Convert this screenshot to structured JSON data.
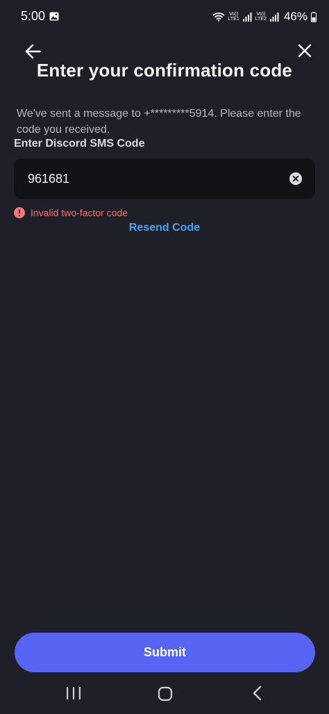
{
  "status_bar": {
    "time": "5:00",
    "sim1_label": "Vo)) LTE1",
    "sim1_line1": "Vo))",
    "sim1_line2": "LTE1",
    "sim2_line1": "Vo))",
    "sim2_line2": "LTE2",
    "battery": "46%"
  },
  "header": {
    "back_icon": "arrow-left-icon",
    "close_icon": "close-icon"
  },
  "title": "Enter your confirmation code",
  "description": "We've sent a message to +*********5914.  Please enter the code you received.",
  "field": {
    "label": "Enter Discord SMS Code",
    "value": "961681",
    "clear_icon": "clear-circle-icon"
  },
  "error": {
    "icon": "error-circle-icon",
    "text": "Invalid two-factor code",
    "color": "#f0787a"
  },
  "resend_label": "Resend Code",
  "submit_label": "Submit",
  "colors": {
    "background": "#1e1f27",
    "accent": "#5865f2",
    "link": "#4aa3f0",
    "input_background": "#121317"
  },
  "nav_bar": {
    "recents_icon": "recents-icon",
    "home_icon": "home-icon",
    "back_icon": "nav-back-icon"
  }
}
